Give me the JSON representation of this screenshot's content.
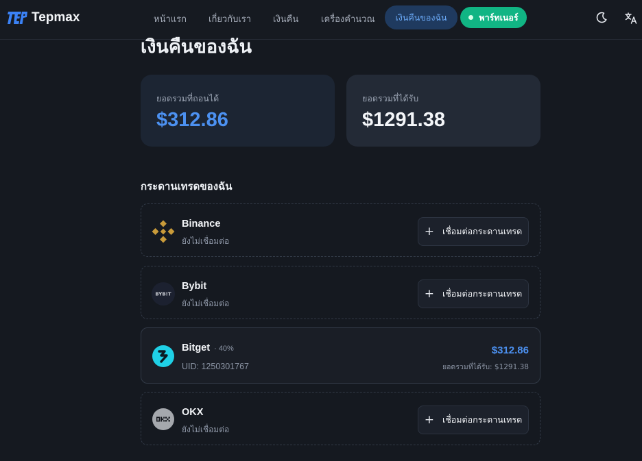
{
  "brand": {
    "name": "Tepmax"
  },
  "nav": {
    "links": [
      "หน้าแรก",
      "เกี่ยวกับเรา",
      "เงินคืน",
      "เครื่องคำนวณ"
    ],
    "active": "เงินคืนของฉัน",
    "partner": "พาร์ทเนอร์",
    "icons": [
      "moon-icon",
      "translate-icon"
    ]
  },
  "page": {
    "title": "เงินคืนของฉัน"
  },
  "stats": {
    "withdrawable_label": "ยอดรวมที่ถอนได้",
    "withdrawable_value": "$312.86",
    "received_label": "ยอดรวมที่ได้รับ",
    "received_value": "$1291.38"
  },
  "exchanges_section": {
    "title": "กระดานเทรดของฉัน",
    "connect_label": "เชื่อมต่อกระดานเทรด",
    "items": [
      {
        "name": "Binance",
        "status": "ยังไม่เชื่อมต่อ",
        "connected": false,
        "icon": "binance-icon"
      },
      {
        "name": "Bybit",
        "status": "ยังไม่เชื่อมต่อ",
        "connected": false,
        "icon": "bybit-icon",
        "logo_text": "BYB!T"
      },
      {
        "name": "Bitget",
        "connected": true,
        "rate": "· 40%",
        "uid": "UID: 1250301767",
        "amount": "$312.86",
        "total": "ยอดรวมที่ได้รับ: $1291.38",
        "icon": "bitget-icon"
      },
      {
        "name": "OKX",
        "status": "ยังไม่เชื่อมต่อ",
        "connected": false,
        "icon": "okx-icon"
      }
    ]
  },
  "colors": {
    "accent": "#4c91f1",
    "partner": "#11b584",
    "background": "#151920"
  }
}
